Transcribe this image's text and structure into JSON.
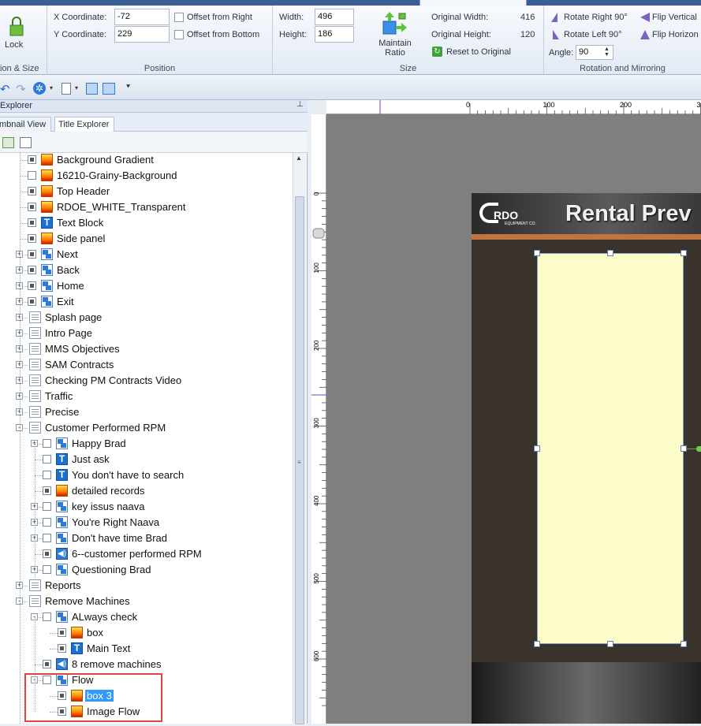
{
  "ribbon": {
    "lock_label": "Lock",
    "size_group_label": "ion & Size",
    "position": {
      "x_label": "X Coordinate:",
      "x_value": "-72",
      "y_label": "Y Coordinate:",
      "y_value": "229",
      "offset_right": "Offset from Right",
      "offset_bottom": "Offset from Bottom",
      "group_label": "Position"
    },
    "size": {
      "width_label": "Width:",
      "width_value": "496",
      "height_label": "Height:",
      "height_value": "186",
      "maintain_ratio": "Maintain\nRatio",
      "orig_width_label": "Original Width:",
      "orig_width_value": "416",
      "orig_height_label": "Original Height:",
      "orig_height_value": "120",
      "reset_label": "Reset to Original",
      "group_label": "Size"
    },
    "rotation": {
      "rotate_right": "Rotate Right 90°",
      "rotate_left": "Rotate Left 90°",
      "flip_vertical": "Flip Vertical",
      "flip_horizontal": "Flip Horizon",
      "angle_label": "Angle:",
      "angle_value": "90",
      "group_label": "Rotation and Mirroring"
    }
  },
  "explorer": {
    "title": "Explorer",
    "tabs": [
      "mbnail View",
      "Title Explorer"
    ],
    "items": [
      {
        "label": "Background Gradient",
        "icon": "image"
      },
      {
        "label": "16210-Grainy-Background",
        "icon": "image"
      },
      {
        "label": "Top Header",
        "icon": "image"
      },
      {
        "label": "RDOE_WHITE_Transparent",
        "icon": "image"
      },
      {
        "label": "Text Block",
        "icon": "text"
      },
      {
        "label": "Side panel",
        "icon": "image"
      },
      {
        "label": "Next",
        "icon": "button"
      },
      {
        "label": "Back",
        "icon": "button"
      },
      {
        "label": "Home",
        "icon": "button"
      },
      {
        "label": "Exit",
        "icon": "button"
      },
      {
        "label": "Splash page",
        "icon": "page"
      },
      {
        "label": "Intro Page",
        "icon": "page"
      },
      {
        "label": "MMS Objectives",
        "icon": "page"
      },
      {
        "label": "SAM Contracts",
        "icon": "page"
      },
      {
        "label": "Checking PM Contracts Video",
        "icon": "page"
      },
      {
        "label": "Traffic",
        "icon": "page"
      },
      {
        "label": "Precise",
        "icon": "page"
      },
      {
        "label": "Customer Performed RPM",
        "icon": "page"
      },
      {
        "label": "Happy Brad",
        "icon": "button"
      },
      {
        "label": "Just ask",
        "icon": "text"
      },
      {
        "label": "You don't have to search",
        "icon": "text"
      },
      {
        "label": "detailed records",
        "icon": "image"
      },
      {
        "label": "key issus naava",
        "icon": "button"
      },
      {
        "label": "You're Right Naava",
        "icon": "button"
      },
      {
        "label": "Don't have time Brad",
        "icon": "button"
      },
      {
        "label": "6--customer performed RPM",
        "icon": "sound"
      },
      {
        "label": "Questioning Brad",
        "icon": "button"
      },
      {
        "label": "Reports",
        "icon": "page"
      },
      {
        "label": "Remove Machines",
        "icon": "page"
      },
      {
        "label": "ALways check",
        "icon": "button"
      },
      {
        "label": "box",
        "icon": "image"
      },
      {
        "label": "Main Text",
        "icon": "text"
      },
      {
        "label": "8 remove machines",
        "icon": "sound"
      },
      {
        "label": "Flow",
        "icon": "button"
      },
      {
        "label": "box 3",
        "icon": "image"
      },
      {
        "label": "Image Flow",
        "icon": "image"
      }
    ]
  },
  "ruler": {
    "h_ticks": [
      "0",
      "100",
      "200",
      "3"
    ],
    "v_ticks": [
      "0",
      "100",
      "200",
      "300",
      "400",
      "500",
      "600"
    ]
  },
  "slide": {
    "header_text": "Rental Prev",
    "logo_text": "RDO",
    "logo_sub": "EQUIPMENT CO."
  }
}
